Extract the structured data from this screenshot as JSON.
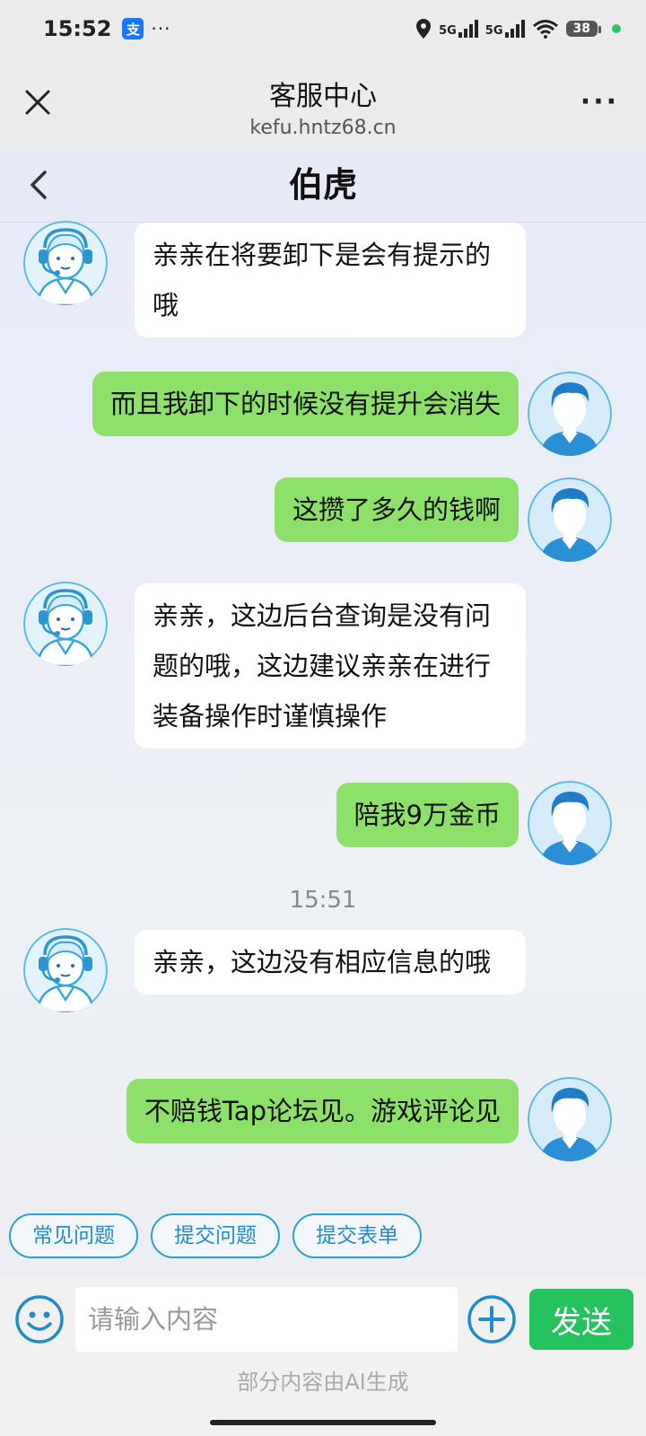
{
  "status_bar": {
    "time": "15:52",
    "app_badge": "支",
    "dots": "···",
    "net1": "5G",
    "net2": "5G",
    "battery": "38"
  },
  "header": {
    "title": "客服中心",
    "subtitle": "kefu.hntz68.cn"
  },
  "chat": {
    "contact_name": "伯虎",
    "messages": [
      {
        "side": "left",
        "text": "亲亲在将要卸下是会有提示的哦"
      },
      {
        "side": "right",
        "text": "而且我卸下的时候没有提升会消失"
      },
      {
        "side": "right",
        "text": "这攒了多久的钱啊"
      },
      {
        "side": "left",
        "text": "亲亲，这边后台查询是没有问题的哦，这边建议亲亲在进行装备操作时谨慎操作"
      },
      {
        "side": "right",
        "text": "陪我9万金币"
      },
      {
        "side": "left",
        "text": "亲亲，这边没有相应信息的哦"
      },
      {
        "side": "right",
        "text": "不赔钱Tap论坛见。游戏评论见"
      }
    ],
    "timestamp": "15:51"
  },
  "quick_actions": [
    "常见问题",
    "提交问题",
    "提交表单"
  ],
  "input": {
    "placeholder": "请输入内容",
    "send_label": "发送",
    "ai_note": "部分内容由AI生成"
  },
  "colors": {
    "self_bubble": "#8de06a",
    "agent_bubble": "#ffffff",
    "send_button": "#24c35e",
    "accent": "#2a9fd6"
  }
}
